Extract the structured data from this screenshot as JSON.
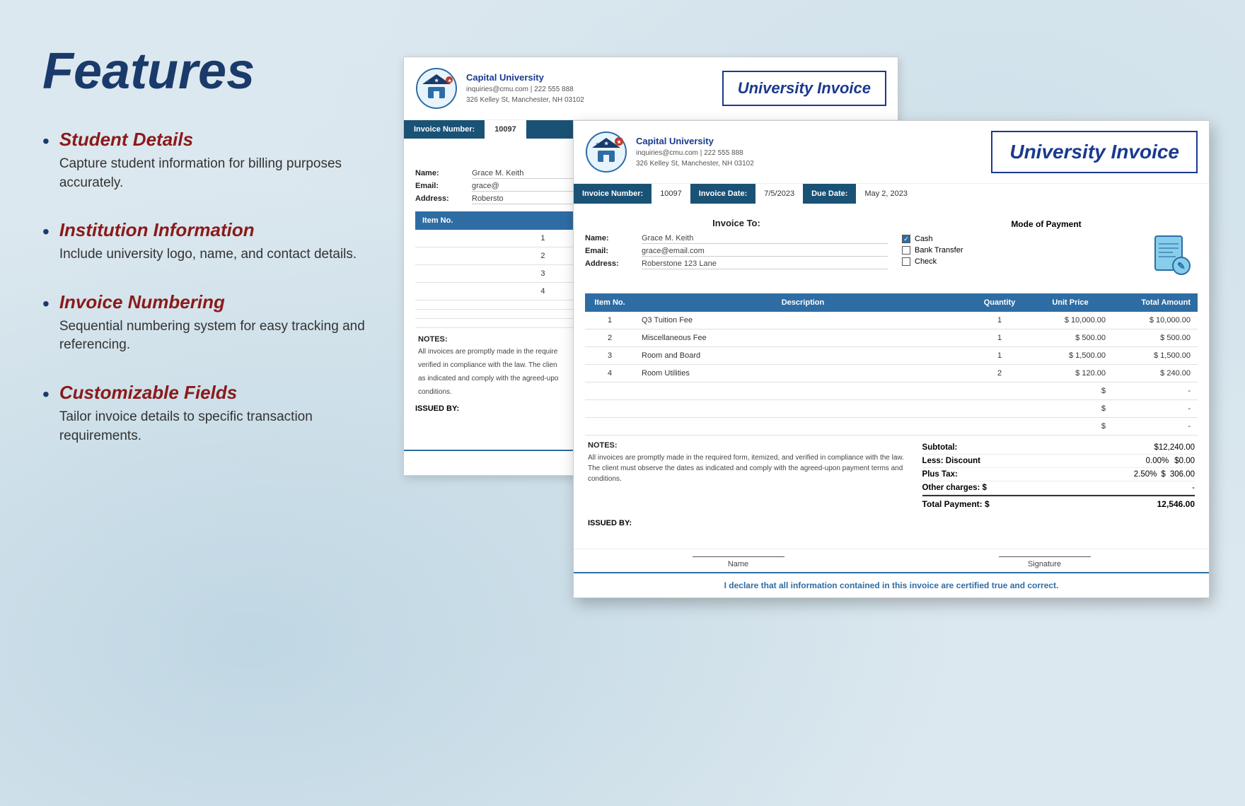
{
  "page": {
    "title": "Features"
  },
  "features": [
    {
      "id": "student-details",
      "heading": "Student Details",
      "description": "Capture student information for billing purposes accurately."
    },
    {
      "id": "institution-information",
      "heading": "Institution Information",
      "description": "Include university logo, name, and contact details."
    },
    {
      "id": "invoice-numbering",
      "heading": "Invoice Numbering",
      "description": "Sequential numbering system for easy tracking and referencing."
    },
    {
      "id": "customizable-fields",
      "heading": "Customizable Fields",
      "description": "Tailor invoice details to specific transaction requirements."
    }
  ],
  "invoice": {
    "university_name": "Capital University",
    "contact": "inquiries@cmu.com | 222 555 888",
    "address": "326 Kelley St, Manchester, NH 03102",
    "title": "University Invoice",
    "number_label": "Invoice Number:",
    "number_value": "10097",
    "date_label": "Invoice Date:",
    "date_value": "7/5/2023",
    "due_label": "Due Date:",
    "due_value": "May 2, 2023",
    "invoice_to_label": "Invoice To:",
    "name_label": "Name:",
    "name_value": "Grace M. Keith",
    "email_label": "Email:",
    "email_value": "grace@email.com",
    "address_label": "Address:",
    "address_value": "Roberstone 123 Lane",
    "payment_mode_title": "Mode of Payment",
    "payment_options": [
      {
        "label": "Cash",
        "checked": true
      },
      {
        "label": "Bank Transfer",
        "checked": false
      },
      {
        "label": "Check",
        "checked": false
      }
    ],
    "table_headers": [
      "Item No.",
      "Description",
      "Quantity",
      "Unit Price",
      "Total Amount"
    ],
    "table_rows": [
      {
        "no": "1",
        "desc": "Q3 Tuition Fee",
        "qty": "1",
        "unit": "$ 10,000.00",
        "total": "$ 10,000.00"
      },
      {
        "no": "2",
        "desc": "Miscellaneous Fee",
        "qty": "1",
        "unit": "$ 500.00",
        "total": "$ 500.00"
      },
      {
        "no": "3",
        "desc": "Room and Board",
        "qty": "1",
        "unit": "$ 1,500.00",
        "total": "$ 1,500.00"
      },
      {
        "no": "4",
        "desc": "Room Utilities",
        "qty": "2",
        "unit": "$ 120.00",
        "total": "$ 240.00"
      },
      {
        "no": "",
        "desc": "",
        "qty": "",
        "unit": "$",
        "total": "-"
      },
      {
        "no": "",
        "desc": "",
        "qty": "",
        "unit": "$",
        "total": "-"
      },
      {
        "no": "",
        "desc": "",
        "qty": "",
        "unit": "$",
        "total": "-"
      }
    ],
    "notes_label": "NOTES:",
    "notes_text": "All invoices are promptly made in the required form, itemized, and verified in compliance with the law. The client must observe the dates as indicated and comply with the agreed-upon payment terms and conditions.",
    "issued_by_label": "ISSUED BY:",
    "subtotal_label": "Subtotal:",
    "subtotal_value": "$12,240.00",
    "discount_label": "Less: Discount",
    "discount_pct": "0.00%",
    "discount_value": "$0.00",
    "tax_label": "Plus Tax:",
    "tax_pct": "2.50%",
    "tax_dollar": "$",
    "tax_value": "306.00",
    "other_label": "Other charges: $",
    "other_value": "-",
    "total_label": "Total Payment: $",
    "total_value": "12,546.00",
    "declaration": "I declare that all information contained in this invoice are certified true and correct.",
    "name_sig_label": "Name",
    "signature_label": "Signature"
  }
}
